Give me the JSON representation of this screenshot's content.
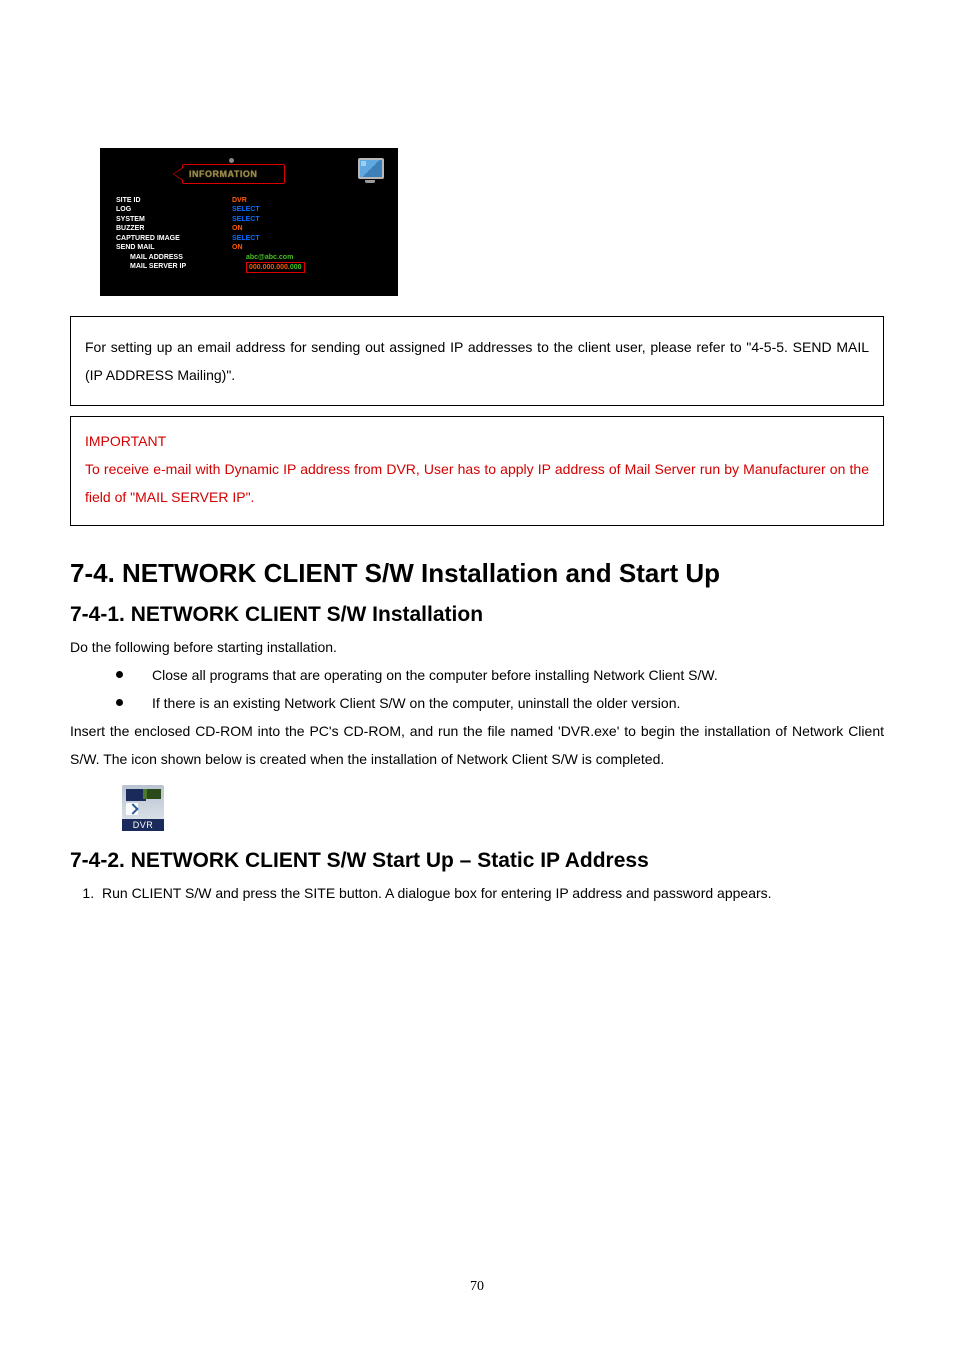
{
  "dvr": {
    "tab": "INFORMATION",
    "rows": [
      {
        "label": "SITE ID",
        "value": "DVR",
        "cls": ""
      },
      {
        "label": "LOG",
        "value": "SELECT",
        "cls": "sel"
      },
      {
        "label": "SYSTEM",
        "value": "SELECT",
        "cls": "sel"
      },
      {
        "label": "BUZZER",
        "value": "ON",
        "cls": ""
      },
      {
        "label": "CAPTURED IMAGE",
        "value": "SELECT",
        "cls": "sel"
      },
      {
        "label": "SEND MAIL",
        "value": "ON",
        "cls": ""
      },
      {
        "label": "MAIL ADDRESS",
        "value": "abc@abc.com",
        "cls": "mail",
        "indent": true
      }
    ],
    "ip_row_label": "MAIL SERVER IP",
    "ip_prefix": "000.000.000.",
    "ip_last": "000"
  },
  "note_box": "For setting up an email address for sending out assigned IP addresses to the client user, please refer to \"4-5-5. SEND MAIL (IP ADDRESS Mailing)\".",
  "important": {
    "heading": "IMPORTANT",
    "body": "To receive e-mail with Dynamic IP address from DVR, User has to apply IP address of Mail Server run by Manufacturer on the field of \"MAIL SERVER IP\"."
  },
  "h2": "7-4. NETWORK CLIENT S/W Installation and Start Up",
  "sec1": {
    "heading": "7-4-1. NETWORK CLIENT S/W Installation",
    "intro": "Do the following before starting installation.",
    "bullets": [
      "Close all programs that are operating on the computer before installing Network Client S/W.",
      "If there is an existing Network Client S/W on the computer, uninstall the older version."
    ],
    "para": "Insert the enclosed CD-ROM into the PC's CD-ROM, and run the file named 'DVR.exe' to begin the installation of Network Client S/W. The icon shown below is created when the installation of Network Client S/W is completed."
  },
  "app_icon_label": "DVR",
  "sec2": {
    "heading": "7-4-2. NETWORK CLIENT S/W Start Up – Static IP Address",
    "step1": "Run CLIENT S/W and press the SITE button. A dialogue box for entering IP address and password appears."
  },
  "page_number": "70"
}
